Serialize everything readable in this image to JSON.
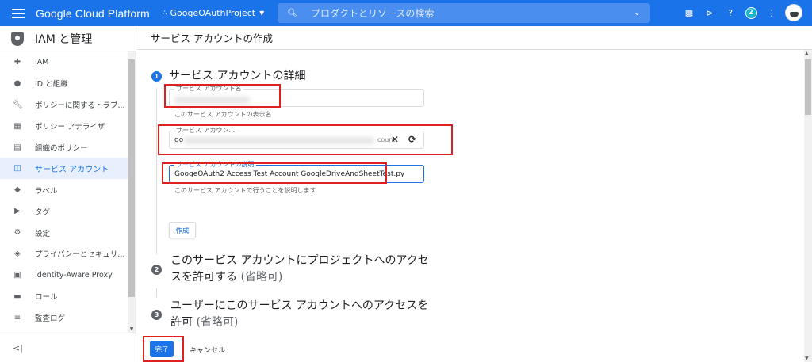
{
  "topbar": {
    "brand": "Google Cloud Platform",
    "project": "GoogeOAuthProject",
    "search_placeholder": "プロダクトとリソースの検索",
    "notification_count": "2"
  },
  "sidebar": {
    "title": "IAM と管理",
    "items": [
      {
        "label": "IAM",
        "icon": "person-add-icon"
      },
      {
        "label": "ID と組織",
        "icon": "account-circle-icon"
      },
      {
        "label": "ポリシーに関するトラブ...",
        "icon": "wrench-icon"
      },
      {
        "label": "ポリシー アナライザ",
        "icon": "policy-analyzer-icon"
      },
      {
        "label": "組織のポリシー",
        "icon": "list-icon"
      },
      {
        "label": "サービス アカウント",
        "icon": "service-account-icon",
        "active": true
      },
      {
        "label": "ラベル",
        "icon": "label-icon"
      },
      {
        "label": "タグ",
        "icon": "tag-icon"
      },
      {
        "label": "設定",
        "icon": "gear-icon"
      },
      {
        "label": "プライバシーとセキュリ...",
        "icon": "shield-icon"
      },
      {
        "label": "Identity-Aware Proxy",
        "icon": "proxy-icon"
      },
      {
        "label": "ロール",
        "icon": "roles-icon"
      },
      {
        "label": "監査ログ",
        "icon": "audit-log-icon"
      }
    ],
    "collapse_label": "<|"
  },
  "main": {
    "page_title": "サービス アカウントの作成",
    "step1": {
      "number": "1",
      "title": "サービス アカウントの詳細",
      "name_label": "サービス アカウント名",
      "name_hint": "このサービス アカウントの表示名",
      "id_label": "サービス アカウン...",
      "id_value_prefix": "go",
      "id_value_suffix": "count",
      "desc_label": "サービス アカウントの説明",
      "desc_value": "GoogeOAuth2 Access Test Account GoogleDriveAndSheetTest.py",
      "desc_hint": "このサービス アカウントで行うことを説明します",
      "create_button": "作成"
    },
    "step2": {
      "number": "2",
      "title_line1": "このサービス アカウントにプロジェクトへのアクセ",
      "title_line2": "スを許可する",
      "optional": "(省略可)"
    },
    "step3": {
      "number": "3",
      "title_line1": "ユーザーにこのサービス アカウントへのアクセスを",
      "title_line2": "許可",
      "optional": "(省略可)"
    },
    "done_button": "完了",
    "cancel_button": "キャンセル"
  },
  "colors": {
    "brand_blue": "#1a73e8",
    "highlight_red": "#e0201f"
  }
}
